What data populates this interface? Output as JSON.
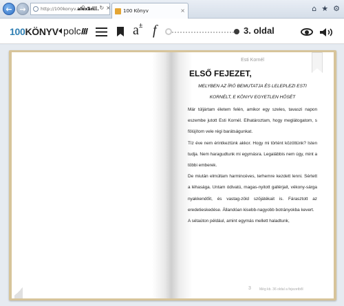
{
  "browser": {
    "address_prefix": "http://100konyv.",
    "address_domain": "alexan...",
    "tab_title": "100 Könyv"
  },
  "toolbar": {
    "logo_num": "100",
    "logo_word": "KÖNYV",
    "shelf_label": "polc",
    "page_indicator": "3. oldal",
    "reading_progress": 0.0,
    "icons": [
      "menu-icon",
      "bookmark-icon",
      "font-size-icon",
      "font-face-icon",
      "eye-icon",
      "volume-icon"
    ]
  },
  "book": {
    "running_head": "Esti Kornél",
    "chapter_title": "ELSŐ FEJEZET,",
    "chapter_subtitle": "MELYBEN AZ ÍRÓ BEMUTATJA ÉS LELEPLEZI ESTI KORNÉLT, E KÖNYV EGYETLEN HŐSÉT",
    "paragraphs": [
      "Már túljártam életem felén, amikor egy szeles, tavaszi napon eszembe jutott Esti Kornél. Elhatároztam, hogy meglátogatom, s fölújítom vele régi barátságunkat.",
      "Tíz éve nem érintkeztünk akkor. Hogy mi történt közöttünk? Isten tudja. Nem haragudtunk mi egymásra. Legalábbis nem úgy, mint a többi emberek.",
      "De miután elmúltam harmincéves, terhemre kezdett lenni. Sértett a léhasága. Untam ódivatú, magas-nyitott gallérjait, vékony-sárga nyakkendőit, és vastag-zöld szöjátékait is. Fárasztott az eredetieskedése. Állandóan kisebb-nagyobb botrányokba kevert.",
      "A sétaúton például, amint egymás mellett haladtunk,"
    ],
    "folio": "3",
    "remaining_note": "Még kb. 36 oldal a fejezetből"
  }
}
